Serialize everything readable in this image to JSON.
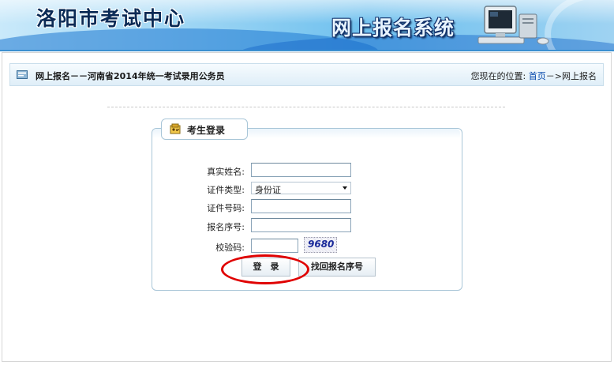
{
  "banner": {
    "site_title": "洛阳市考试中心",
    "system_title": "网上报名系统"
  },
  "breadcrumb_bar": {
    "title": "网上报名－－河南省2014年统一考试录用公务员",
    "location_prefix": "您现在的位置:",
    "home_link": "首页",
    "separator": "－>",
    "current": "网上报名"
  },
  "login": {
    "tab_label": "考生登录",
    "fields": {
      "name_label": "真实姓名:",
      "name_value": "",
      "id_type_label": "证件类型:",
      "id_type_selected": "身份证",
      "id_number_label": "证件号码:",
      "id_number_value": "",
      "reg_no_label": "报名序号:",
      "reg_no_value": "",
      "captcha_label": "校验码:",
      "captcha_value": "",
      "captcha_image_text": "9680"
    },
    "login_button": "登　录",
    "recover_button": "找回报名序号"
  },
  "colors": {
    "link": "#0044aa",
    "highlight_circle": "#e00000",
    "banner_blue": "#3a8fd0"
  },
  "icons": [
    "folder-icon",
    "login-icon",
    "computer-icon",
    "chevron-down-icon"
  ]
}
